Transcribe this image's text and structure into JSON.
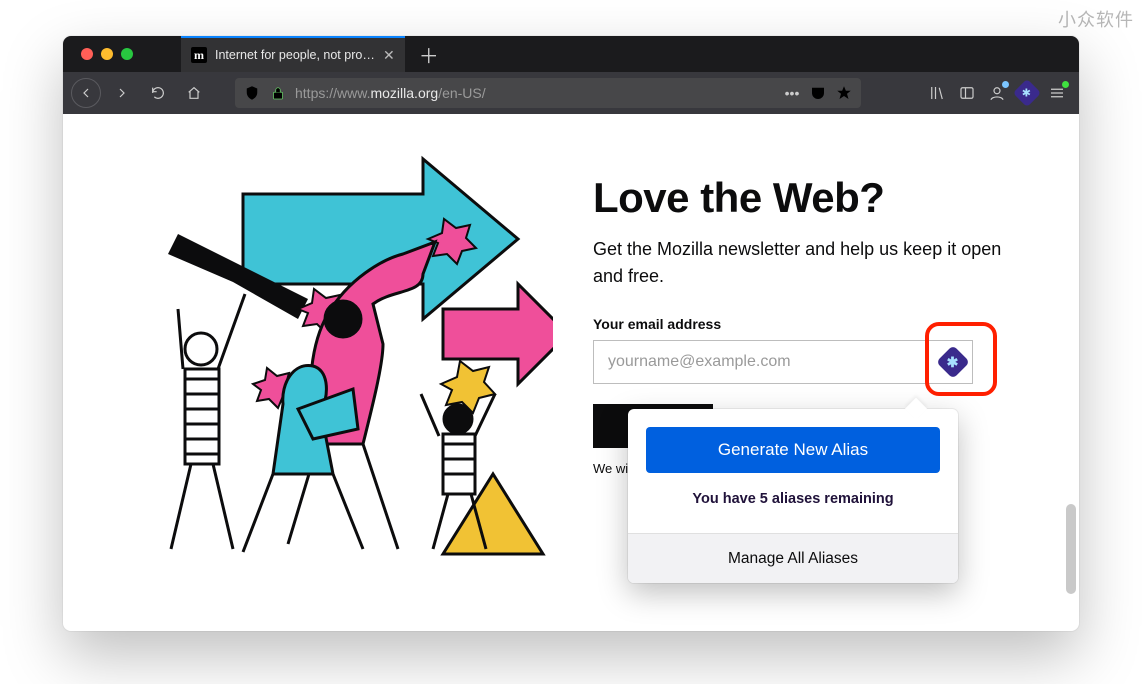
{
  "watermark": "小众软件",
  "tab": {
    "favicon_letter": "m",
    "title": "Internet for people, not profit — …"
  },
  "url": {
    "protocol": "https://",
    "host": "www.",
    "domain": "mozilla.org",
    "path": "/en-US/"
  },
  "page": {
    "headline": "Love the Web?",
    "subhead": "Get the Mozilla newsletter and help us keep it open and free.",
    "email_label": "Your email address",
    "email_placeholder": "yourname@example.com",
    "disclaimer": "We will o"
  },
  "popup": {
    "generate_label": "Generate New Alias",
    "remaining_label": "You have 5 aliases remaining",
    "manage_label": "Manage All Aliases"
  },
  "colors": {
    "primary_button": "#0060df",
    "relay_brand": "#3a2a8c",
    "highlight_red": "#ff1f00"
  }
}
